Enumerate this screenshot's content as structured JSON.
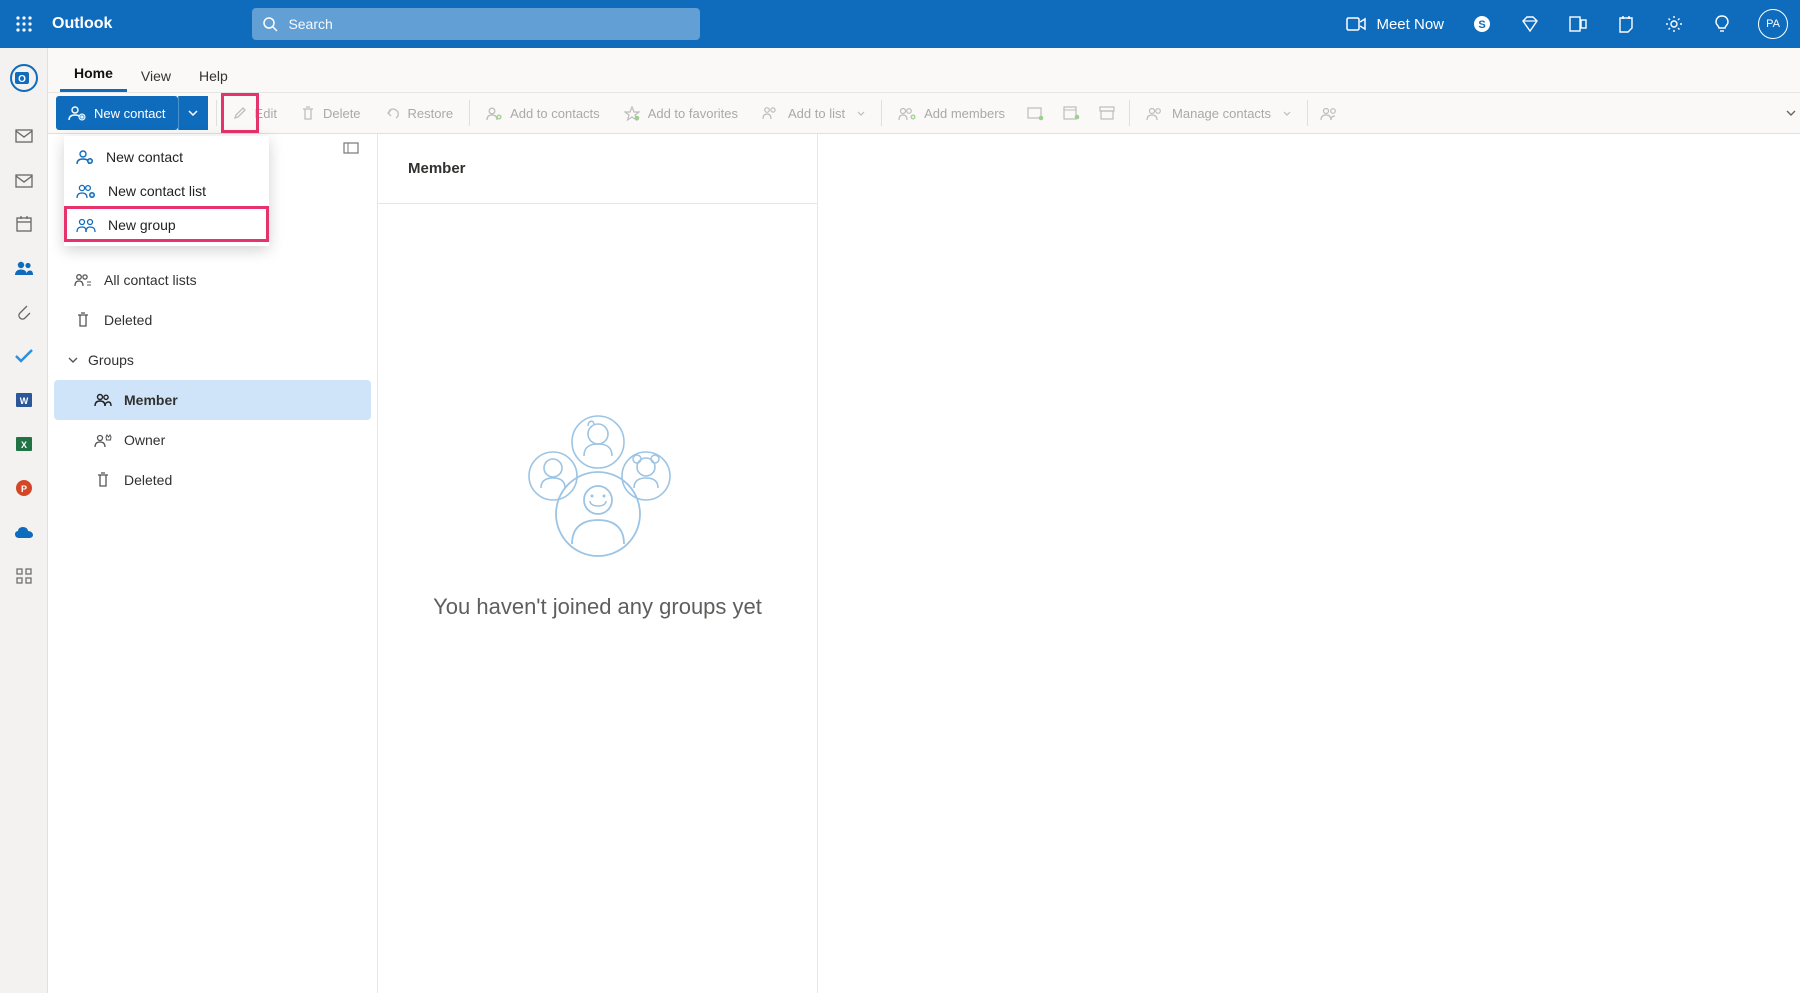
{
  "topbar": {
    "app_title": "Outlook",
    "search_placeholder": "Search",
    "meet_now": "Meet Now",
    "avatar_initials": "PA"
  },
  "tabs": {
    "home": "Home",
    "view": "View",
    "help": "Help"
  },
  "ribbon": {
    "new_contact": "New contact",
    "edit": "Edit",
    "delete": "Delete",
    "restore": "Restore",
    "add_to_contacts": "Add to contacts",
    "add_to_favorites": "Add to favorites",
    "add_to_list": "Add to list",
    "add_members": "Add members",
    "manage_contacts": "Manage contacts"
  },
  "dropdown": {
    "items": [
      {
        "label": "New contact"
      },
      {
        "label": "New contact list"
      },
      {
        "label": "New group"
      }
    ],
    "highlight_index": 2
  },
  "nav": {
    "all_contact_lists": "All contact lists",
    "deleted": "Deleted",
    "groups": "Groups",
    "member": "Member",
    "owner": "Owner",
    "deleted2": "Deleted"
  },
  "list": {
    "header": "Member",
    "empty_message": "You haven't joined any groups yet"
  },
  "colors": {
    "primary": "#0f6cbd",
    "highlight": "#e6336b"
  }
}
